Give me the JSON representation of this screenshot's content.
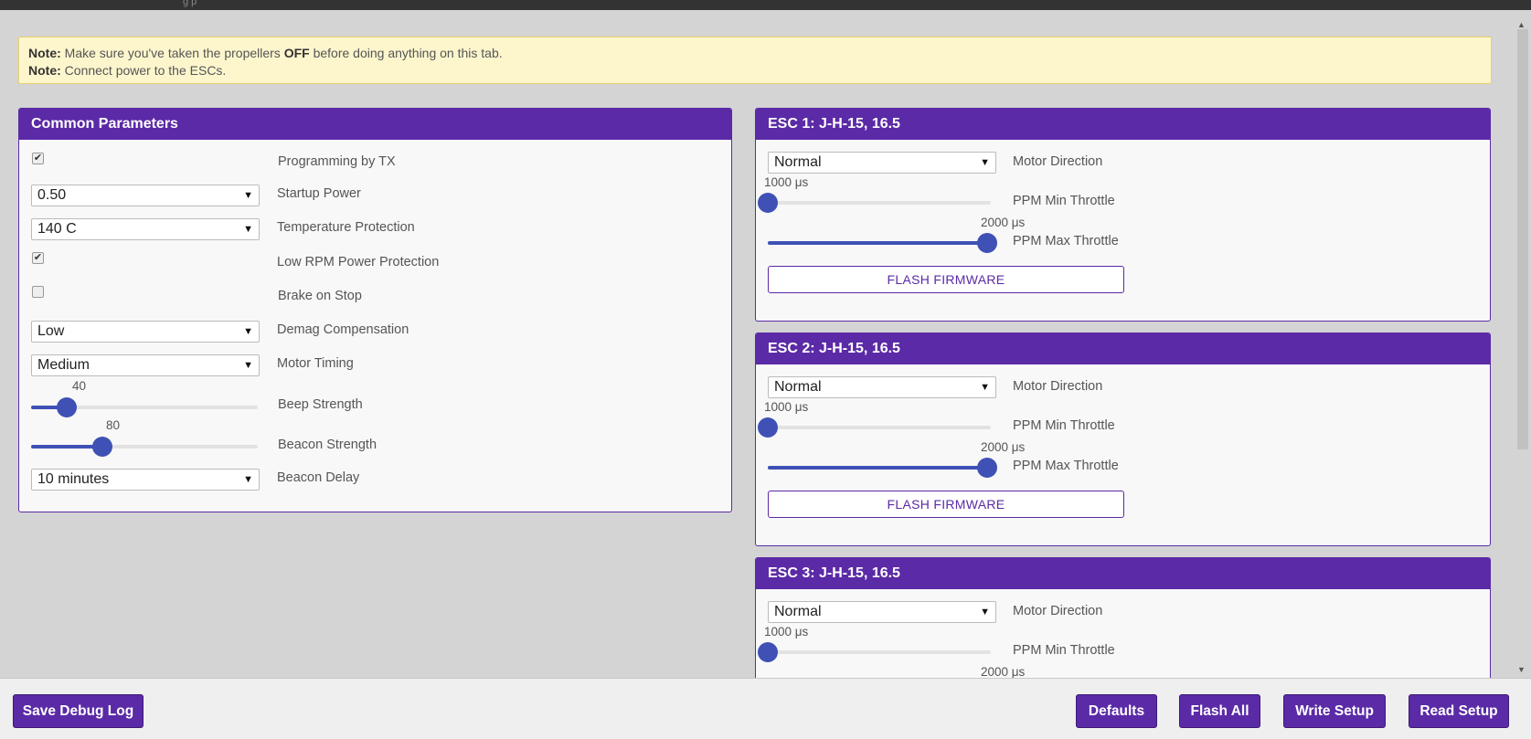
{
  "window": {
    "title_fragment": "g  p"
  },
  "note": {
    "line1_prefix": "Note:",
    "line1_text_a": " Make sure you've taken the propellers ",
    "line1_bold": "OFF",
    "line1_text_b": " before doing anything on this tab.",
    "line2_prefix": "Note:",
    "line2_text": " Connect power to the ESCs."
  },
  "common": {
    "title": "Common Parameters",
    "programming_tx": {
      "label": "Programming by TX",
      "checked": true
    },
    "startup_power": {
      "label": "Startup Power",
      "value": "0.50"
    },
    "temp_protection": {
      "label": "Temperature Protection",
      "value": "140 C"
    },
    "low_rpm": {
      "label": "Low RPM Power Protection",
      "checked": true
    },
    "brake_on_stop": {
      "label": "Brake on Stop",
      "checked": false
    },
    "demag": {
      "label": "Demag Compensation",
      "value": "Low"
    },
    "motor_timing": {
      "label": "Motor Timing",
      "value": "Medium"
    },
    "beep_strength": {
      "label": "Beep Strength",
      "value": "40",
      "fraction": 0.157
    },
    "beacon_strength": {
      "label": "Beacon Strength",
      "value": "80",
      "fraction": 0.314
    },
    "beacon_delay": {
      "label": "Beacon Delay",
      "value": "10 minutes"
    }
  },
  "escs": [
    {
      "title": "ESC 1: J-H-15, 16.5",
      "direction": "Normal",
      "direction_label": "Motor Direction",
      "min_value": "1000 μs",
      "min_label": "PPM Min Throttle",
      "max_value": "2000 μs",
      "max_label": "PPM Max Throttle",
      "flash_label": "FLASH FIRMWARE"
    },
    {
      "title": "ESC 2: J-H-15, 16.5",
      "direction": "Normal",
      "direction_label": "Motor Direction",
      "min_value": "1000 μs",
      "min_label": "PPM Min Throttle",
      "max_value": "2000 μs",
      "max_label": "PPM Max Throttle",
      "flash_label": "FLASH FIRMWARE"
    },
    {
      "title": "ESC 3: J-H-15, 16.5",
      "direction": "Normal",
      "direction_label": "Motor Direction",
      "min_value": "1000 μs",
      "min_label": "PPM Min Throttle",
      "max_value": "2000 μs"
    }
  ],
  "footer": {
    "save_debug": "Save Debug Log",
    "defaults": "Defaults",
    "flash_all": "Flash All",
    "write_setup": "Write Setup",
    "read_setup": "Read Setup"
  },
  "colors": {
    "accent": "#5b2aa6",
    "slider": "#3f51b5",
    "note_bg": "#fdf6cd"
  },
  "glyphs": {
    "check": "✔",
    "dropdown": "▼",
    "scroll_up": "▲",
    "scroll_down": "▼"
  }
}
